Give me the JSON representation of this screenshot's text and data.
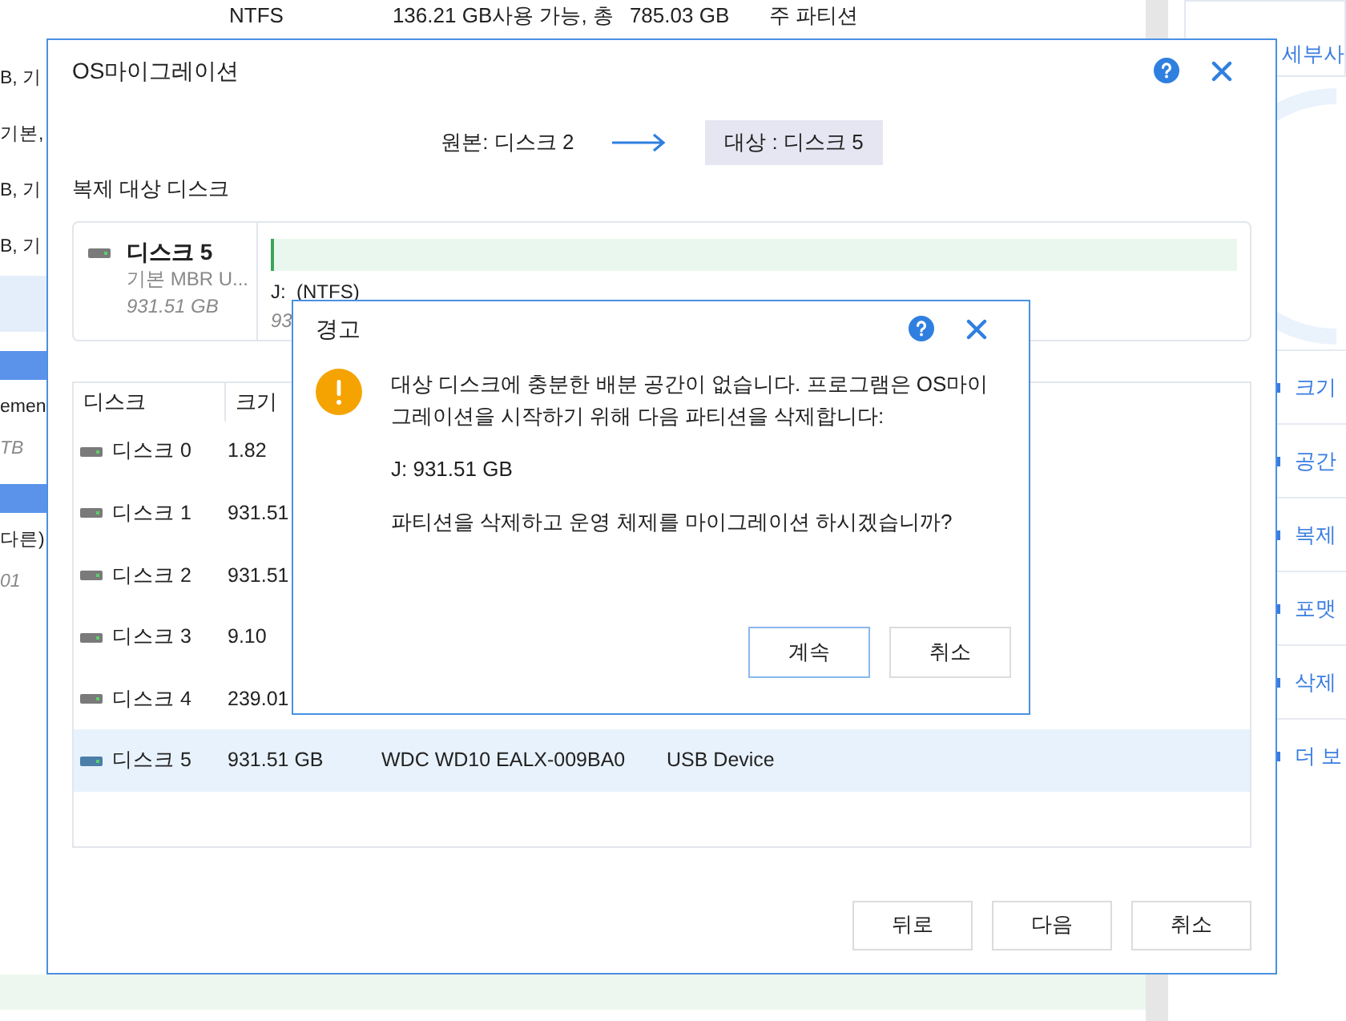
{
  "background": {
    "top_row": {
      "filesystem": "NTFS",
      "free_space": "136.21 GB사용 가능, 총",
      "total": "785.03 GB",
      "type": "주 파티션"
    },
    "left_fragments": [
      {
        "text": "B, 기",
        "kind": "text"
      },
      {
        "text": "기본,",
        "kind": "text"
      },
      {
        "text": "B, 기",
        "kind": "text"
      },
      {
        "text": "B, 기",
        "kind": "text"
      },
      {
        "kind": "selected"
      },
      {
        "kind": "bar"
      },
      {
        "text": "emen",
        "kind": "text"
      },
      {
        "text": "TB",
        "kind": "italic"
      },
      {
        "kind": "bar"
      },
      {
        "text": "다른)",
        "kind": "text"
      },
      {
        "text": "01",
        "kind": "italic"
      }
    ],
    "side_panel": {
      "title": "세부사",
      "actions": [
        "크기",
        "공간",
        "복제",
        "포맷",
        "삭제",
        "더 보"
      ]
    }
  },
  "dialog": {
    "title": "OS마이그레이션",
    "source": "원본: 디스크 2",
    "target": "대상 : 디스크 5",
    "section_label": "복제 대상 디스크",
    "target_disk": {
      "name": "디스크 5",
      "type": "기본 MBR U...",
      "size": "931.51 GB",
      "partition_label": "J:  (NTFS)",
      "partition_size": "93",
      "level": 0.003
    },
    "table": {
      "columns": [
        "디스크",
        "크기"
      ],
      "rows": [
        {
          "disk": "디스크 0",
          "size": "1.82",
          "selected": false
        },
        {
          "disk": "디스크 1",
          "size": "931.51",
          "selected": false
        },
        {
          "disk": "디스크 2",
          "size": "931.51",
          "selected": false
        },
        {
          "disk": "디스크 3",
          "size": "9.10",
          "selected": false
        },
        {
          "disk": "디스크 4",
          "size": "239.01",
          "selected": false
        },
        {
          "disk": "디스크 5",
          "size": "931.51 GB",
          "model": "WDC WD10 EALX-009BA0",
          "interface": "USB Device",
          "selected": true
        }
      ]
    },
    "buttons": [
      "뒤로",
      "다음",
      "취소"
    ]
  },
  "warning": {
    "title": "경고",
    "message": "대상 디스크에 충분한 배분 공간이 없습니다. 프로그램은 OS마이그레이션을 시작하기 위해 다음 파티션을 삭제합니다:",
    "partition": "J: 931.51 GB",
    "question": "파티션을 삭제하고 운영 체제를 마이그레이션 하시겠습니까?",
    "buttons": [
      {
        "label": "계속",
        "selected": true
      },
      {
        "label": "취소",
        "selected": false
      }
    ]
  }
}
